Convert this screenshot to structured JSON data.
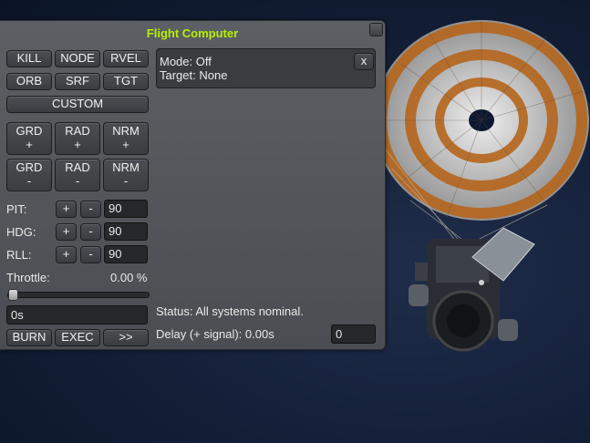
{
  "window": {
    "title": "Flight Computer",
    "accent_color": "#b6f000"
  },
  "reference_buttons": [
    "KILL",
    "NODE",
    "RVEL",
    "ORB",
    "SRF",
    "TGT"
  ],
  "custom_label": "CUSTOM",
  "direction_buttons": [
    [
      "GRD",
      "+"
    ],
    [
      "RAD",
      "+"
    ],
    [
      "NRM",
      "+"
    ],
    [
      "GRD",
      "-"
    ],
    [
      "RAD",
      "-"
    ],
    [
      "NRM",
      "-"
    ]
  ],
  "attitude": {
    "pitch": {
      "label": "PIT:",
      "value": "90"
    },
    "heading": {
      "label": "HDG:",
      "value": "90"
    },
    "roll": {
      "label": "RLL:",
      "value": "90"
    },
    "plus": "+",
    "minus": "-"
  },
  "throttle": {
    "label": "Throttle:",
    "value_text": "0.00 %",
    "fraction": 0.0
  },
  "burn_time_value": "0s",
  "bottom_buttons": {
    "burn": "BURN",
    "exec": "EXEC",
    "next": ">>"
  },
  "info": {
    "mode": "Mode: Off",
    "target": "Target: None",
    "close": "x"
  },
  "status": "Status: All systems nominal.",
  "delay": {
    "label": "Delay (+ signal): 0.00s",
    "value": "0"
  },
  "icons": {
    "window_close": "window-close-icon"
  }
}
